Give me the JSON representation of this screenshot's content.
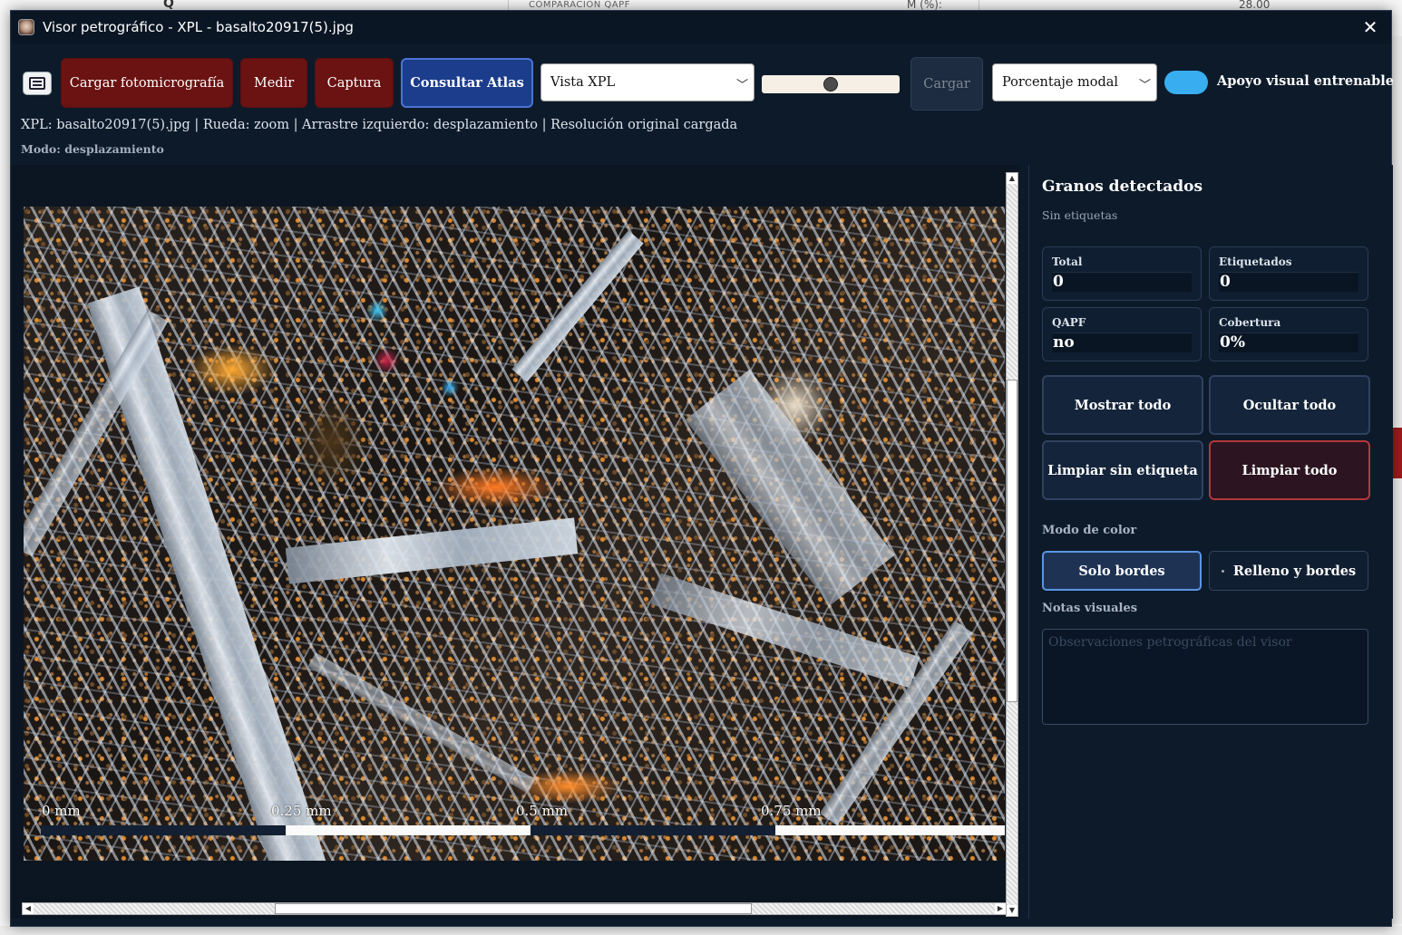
{
  "background_app": {
    "section_header": "COMPARACIÓN QAPF",
    "field_label": "M (%):",
    "field_value": "28.00",
    "corner_letter": "Q"
  },
  "window": {
    "title": "Visor petrográfico - XPL - basalto20917(5).jpg",
    "close_glyph": "✕"
  },
  "toolbar": {
    "load_photo": "Cargar fotomicrografía",
    "measure": "Medir",
    "capture": "Captura",
    "atlas": "Consultar Atlas",
    "view_select": "Vista XPL",
    "slider_value": 0.5,
    "load_disabled": "Cargar",
    "metric_select": "Porcentaje modal",
    "toggle_on": true,
    "toggle_label": "Apoyo visual entrenable"
  },
  "status": {
    "info": "XPL: basalto20917(5).jpg | Rueda: zoom | Arrastre izquierdo: desplazamiento | Resolución original cargada",
    "mode": "Modo: desplazamiento"
  },
  "viewer": {
    "scale_labels": [
      "0 mm",
      "0.25 mm",
      "0.5 mm",
      "0.75 mm"
    ]
  },
  "panel": {
    "title": "Granos detectados",
    "subtitle": "Sin etiquetas",
    "stats": {
      "total_label": "Total",
      "total_value": "0",
      "labeled_label": "Etiquetados",
      "labeled_value": "0",
      "qapf_label": "QAPF",
      "qapf_value": "no",
      "coverage_label": "Cobertura",
      "coverage_value": "0%"
    },
    "show_all": "Mostrar todo",
    "hide_all": "Ocultar todo",
    "clear_unlabeled": "Limpiar sin etiqueta",
    "clear_all": "Limpiar todo",
    "color_mode_label": "Modo de color",
    "color_mode_borders": "Solo bordes",
    "color_mode_fill": "Relleno y bordes",
    "notes_label": "Notas visuales",
    "notes_placeholder": "Observaciones petrográficas del visor"
  }
}
